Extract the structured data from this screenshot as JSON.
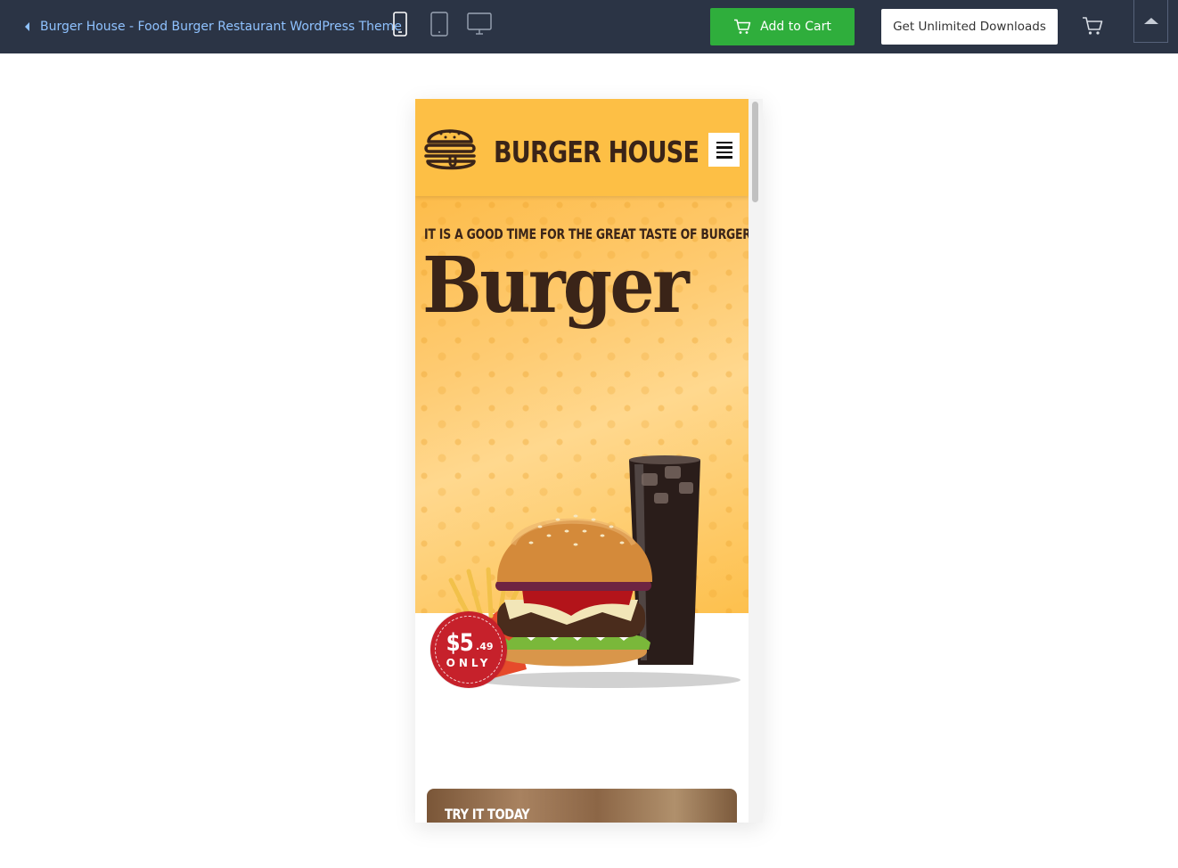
{
  "topbar": {
    "back_label": "Burger House - Food Burger Restaurant WordPress Theme",
    "devices": [
      "mobile-icon",
      "tablet-icon",
      "desktop-icon"
    ],
    "add_to_cart_label": "Add to Cart",
    "unlimited_label": "Get Unlimited Downloads",
    "colors": {
      "bar": "#2b3445",
      "link": "#8fc2ff",
      "cart_button": "#2fae3c"
    }
  },
  "site": {
    "brand": "BURGER HOUSE",
    "tagline": "IT IS A GOOD TIME FOR THE GREAT TASTE OF BURGERS",
    "hero_title": "Burger",
    "price": {
      "main": "$5",
      "cents": ".49",
      "note": "ONLY"
    },
    "try_title": "TRY IT TODAY",
    "colors": {
      "header": "#fdbf45",
      "text_dark": "#3a2418",
      "badge": "#c6212b"
    }
  }
}
